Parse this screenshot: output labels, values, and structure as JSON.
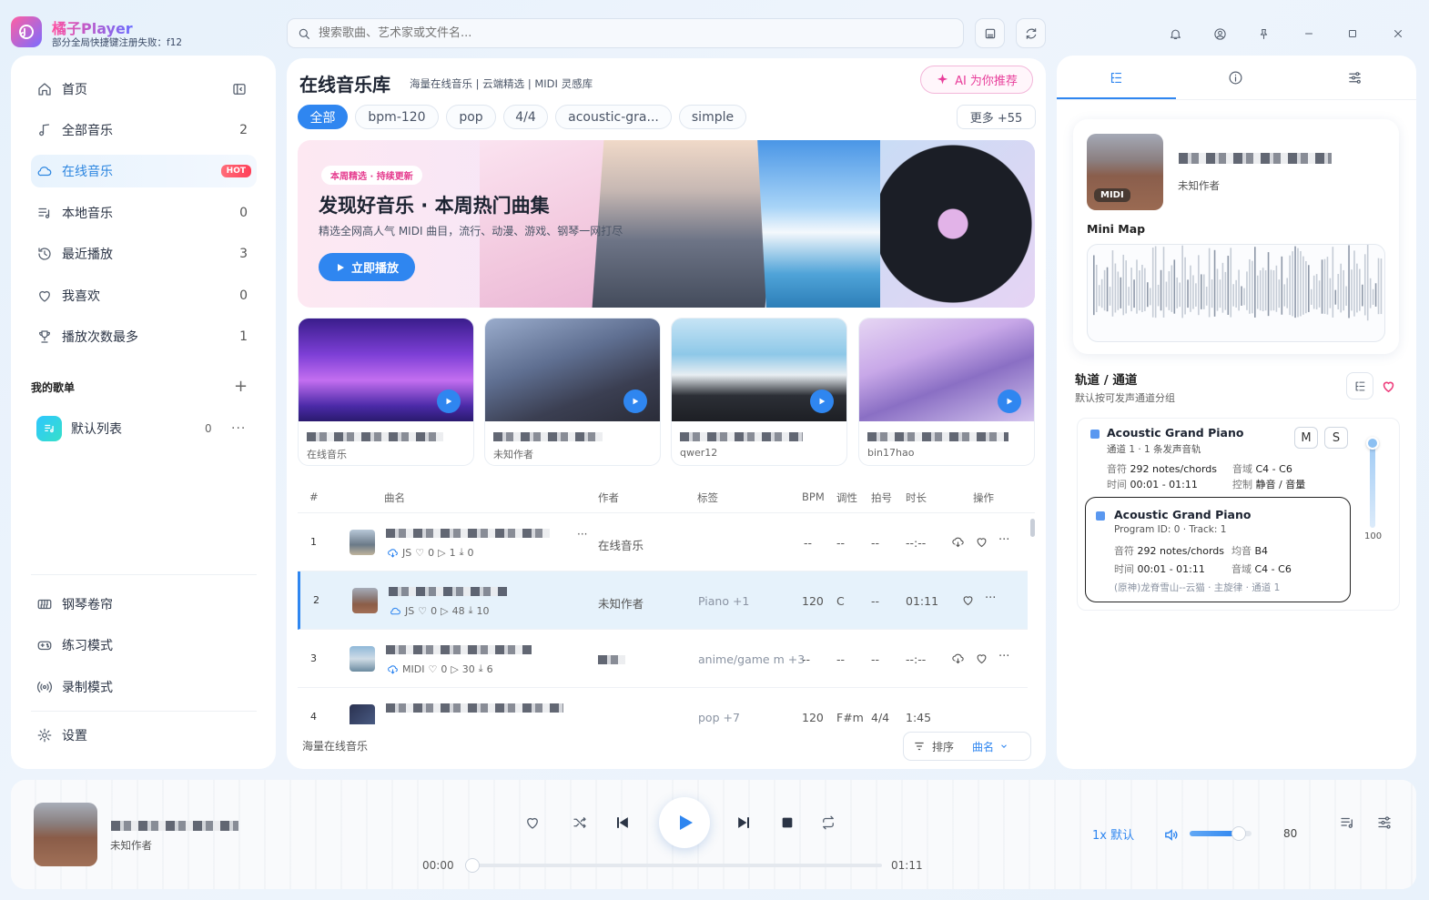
{
  "app": {
    "name": "橘子Player",
    "subtitle": "部分全局快捷键注册失败：f12"
  },
  "search": {
    "placeholder": "搜索歌曲、艺术家或文件名..."
  },
  "sidebar": {
    "items": [
      {
        "label": "首页",
        "icon": "home-icon"
      },
      {
        "label": "全部音乐",
        "count": "2",
        "icon": "music-note-icon"
      },
      {
        "label": "在线音乐",
        "badge": "HOT",
        "icon": "cloud-icon"
      },
      {
        "label": "本地音乐",
        "count": "0",
        "icon": "local-list-icon"
      },
      {
        "label": "最近播放",
        "count": "3",
        "icon": "history-icon"
      },
      {
        "label": "我喜欢",
        "count": "0",
        "icon": "heart-icon"
      },
      {
        "label": "播放次数最多",
        "count": "1",
        "icon": "trophy-icon"
      }
    ],
    "playlists_title": "我的歌单",
    "playlist": {
      "label": "默认列表",
      "count": "0"
    },
    "bottom": [
      {
        "label": "钢琴卷帘",
        "icon": "piano-icon"
      },
      {
        "label": "练习模式",
        "icon": "gamepad-icon"
      },
      {
        "label": "录制模式",
        "icon": "broadcast-icon"
      }
    ],
    "settings": "设置"
  },
  "main": {
    "title": "在线音乐库",
    "subtitle": "海量在线音乐 | 云端精选 | MIDI 灵感库",
    "ai_button": "AI 为你推荐",
    "tags": [
      "全部",
      "bpm-120",
      "pop",
      "4/4",
      "acoustic-gra...",
      "simple"
    ],
    "more_tags": "更多 +55",
    "banner": {
      "badge": "本周精选 · 持续更新",
      "title": "发现好音乐 · 本周热门曲集",
      "desc": "精选全网高人气 MIDI 曲目，流行、动漫、游戏、钢琴一网打尽",
      "play": "立即播放"
    },
    "cards": [
      {
        "author": "在线音乐"
      },
      {
        "author": "未知作者"
      },
      {
        "author": "qwer12"
      },
      {
        "author": "bin17hao"
      }
    ],
    "table": {
      "headers": {
        "num": "#",
        "name": "曲名",
        "author": "作者",
        "tag": "标签",
        "bpm": "BPM",
        "key": "调性",
        "beat": "拍号",
        "dur": "时长",
        "op": "操作"
      },
      "rows": [
        {
          "num": "1",
          "src": "JS",
          "likes": "0",
          "plays": "1",
          "downloads": "0",
          "author": "在线音乐",
          "tag": "",
          "bpm": "--",
          "key": "--",
          "beat": "--",
          "dur": "--:--"
        },
        {
          "num": "2",
          "src": "JS",
          "likes": "0",
          "plays": "48",
          "downloads": "10",
          "author": "未知作者",
          "tag": "Piano +1",
          "bpm": "120",
          "key": "C",
          "beat": "--",
          "dur": "01:11"
        },
        {
          "num": "3",
          "src": "MIDI",
          "likes": "0",
          "plays": "30",
          "downloads": "6",
          "author": "",
          "tag": "anime/game m +3",
          "bpm": "--",
          "key": "--",
          "beat": "--",
          "dur": "--:--"
        },
        {
          "num": "4",
          "src": "",
          "likes": "",
          "plays": "",
          "downloads": "",
          "author": "",
          "tag": "pop +7",
          "bpm": "120",
          "key": "F#m",
          "beat": "4/4",
          "dur": "1:45"
        }
      ]
    },
    "footer": "海量在线音乐",
    "sort_label": "排序",
    "sort_value": "曲名"
  },
  "right": {
    "midi_badge": "MIDI",
    "author": "未知作者",
    "minimap_label": "Mini Map",
    "tracks_title": "轨道 / 通道",
    "tracks_sub": "默认按可发声通道分组",
    "track1": {
      "name": "Acoustic Grand Piano",
      "sub": "通道 1 · 1 条发声音轨",
      "notes_k": "音符",
      "notes_v": "292 notes/chords",
      "range_k": "音域",
      "range_v": "C4 - C6",
      "time_k": "时间",
      "time_v": "00:01 - 01:11",
      "ctrl_k": "控制",
      "ctrl_v": "静音 / 音量",
      "m": "M",
      "s": "S"
    },
    "track2": {
      "name": "Acoustic Grand Piano",
      "sub": "Program ID: 0 · Track: 1",
      "notes_k": "音符",
      "notes_v": "292 notes/chords",
      "avg_k": "均音",
      "avg_v": "B4",
      "time_k": "时间",
      "time_v": "00:01 - 01:11",
      "range_k": "音域",
      "range_v": "C4 - C6",
      "foot": "(原神)龙脊雪山--云猫 · 主旋律 · 通道 1"
    },
    "volume": "100"
  },
  "player": {
    "author": "未知作者",
    "current": "00:00",
    "total": "01:11",
    "progress": 0.0,
    "speed": "1x 默认",
    "volume": "80",
    "volume_level": 0.8
  },
  "colors": {
    "accent": "#2f86f0",
    "hot": "#ff4058",
    "ai": "#e83d9a"
  }
}
